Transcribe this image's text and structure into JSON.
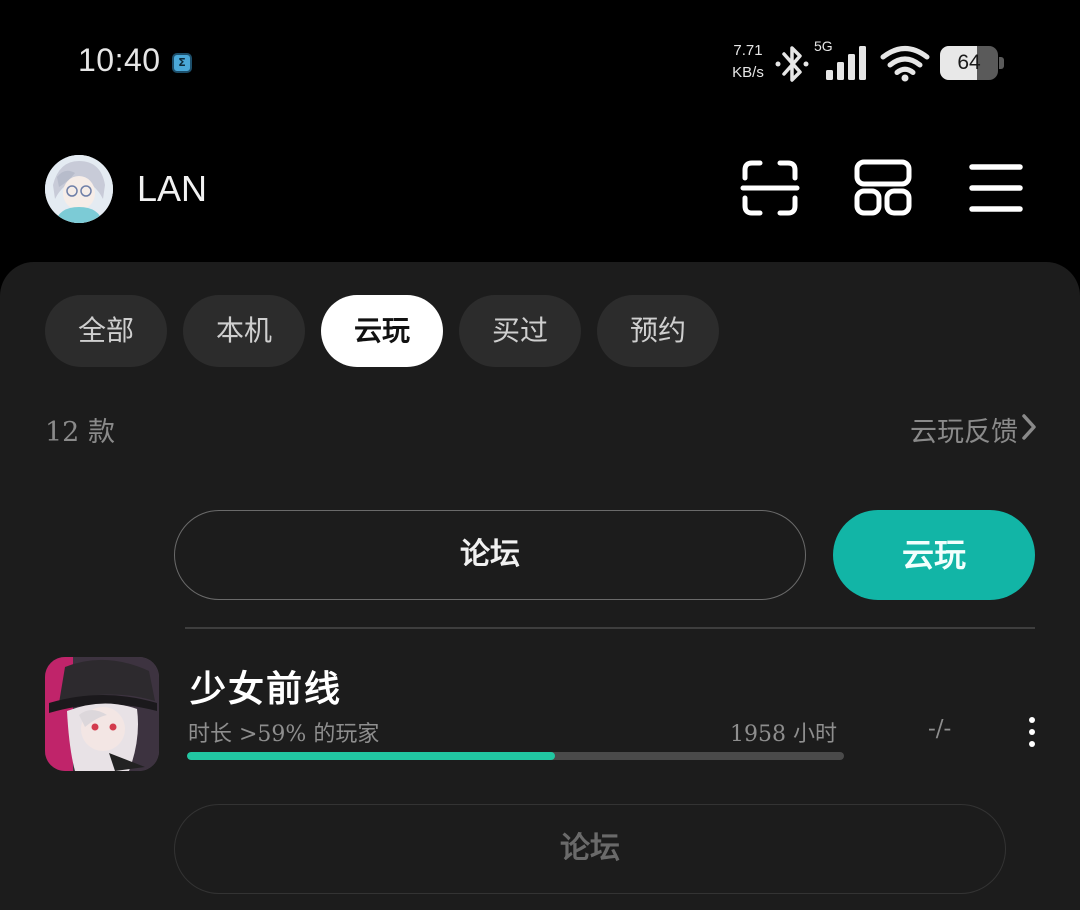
{
  "status_bar": {
    "time": "10:40",
    "app_badge": "Σ",
    "net_speed_value": "7.71",
    "net_speed_unit": "KB/s",
    "signal_label": "5G",
    "battery_level": "64",
    "battery_fraction": 0.64
  },
  "header": {
    "username": "LAN",
    "icons": [
      "scan-icon",
      "grid-icon",
      "menu-icon"
    ]
  },
  "tabs": [
    {
      "label": "全部",
      "active": false
    },
    {
      "label": "本机",
      "active": false
    },
    {
      "label": "云玩",
      "active": true
    },
    {
      "label": "买过",
      "active": false
    },
    {
      "label": "预约",
      "active": false
    }
  ],
  "list": {
    "count_label": "12 款",
    "feedback_label": "云玩反馈"
  },
  "prev_item": {
    "forum_label": "论坛",
    "cloud_play_label": "云玩"
  },
  "game": {
    "title": "少女前线",
    "stat_label": "时长 >59% 的玩家",
    "hours_label": "1958 小时",
    "rating": "-/-",
    "playtime_percent": 0.56,
    "forum_label": "论坛"
  },
  "colors": {
    "accent": "#12b5a6",
    "progress": "#21c7a2",
    "panel": "#1c1c1c"
  }
}
